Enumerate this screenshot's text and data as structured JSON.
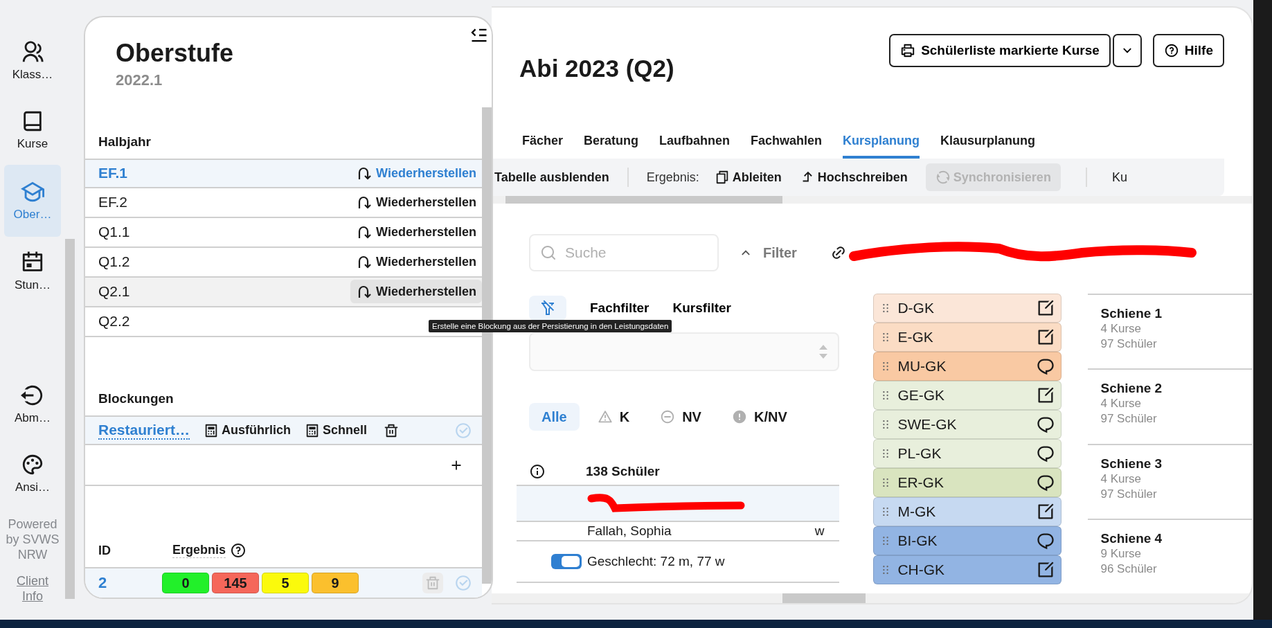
{
  "nav": {
    "items": [
      {
        "label": "Klass…",
        "selected": false
      },
      {
        "label": "Kurse",
        "selected": false
      },
      {
        "label": "Ober…",
        "selected": true
      },
      {
        "label": "Stun…",
        "selected": false
      }
    ],
    "bottom_items": [
      {
        "label": "Abm…"
      },
      {
        "label": "Ansi…"
      }
    ],
    "powered_by": "Powered by SVWS NRW",
    "client_info": "Client Info"
  },
  "sidebar": {
    "title": "Oberstufe",
    "subtitle": "2022.1",
    "halbjahr_heading": "Halbjahr",
    "halbjahre": [
      {
        "label": "EF.1",
        "action": "Wiederherstellen",
        "selected": true,
        "hovered": false
      },
      {
        "label": "EF.2",
        "action": "Wiederherstellen",
        "selected": false,
        "hovered": false
      },
      {
        "label": "Q1.1",
        "action": "Wiederherstellen",
        "selected": false,
        "hovered": false
      },
      {
        "label": "Q1.2",
        "action": "Wiederherstellen",
        "selected": false,
        "hovered": false
      },
      {
        "label": "Q2.1",
        "action": "Wiederherstellen",
        "selected": false,
        "hovered": true
      },
      {
        "label": "Q2.2",
        "selected": false,
        "hovered": false
      }
    ],
    "tooltip": "Erstelle eine Blockung aus der Persistierung in den Leistungsdaten",
    "blockungen_heading": "Blockungen",
    "blockungen": [
      {
        "name": "Restauriert…",
        "detailed": "Ausführlich",
        "quick": "Schnell",
        "selected": true
      }
    ],
    "results_columns": [
      "ID",
      "Ergebnis"
    ],
    "results": [
      {
        "id": "2",
        "selected": true,
        "delete_disabled": true,
        "badges": [
          {
            "value": "0",
            "color": "#22f02a"
          },
          {
            "value": "145",
            "color": "#f5675a"
          },
          {
            "value": "5",
            "color": "#fbfa0c"
          },
          {
            "value": "9",
            "color": "#fbc02d"
          }
        ]
      }
    ]
  },
  "main": {
    "title": "Abi 2023 (Q2)",
    "print_button": "Schülerliste markierte Kurse",
    "help_button": "Hilfe",
    "tabs": [
      {
        "label": "Fächer",
        "selected": false
      },
      {
        "label": "Beratung",
        "selected": false
      },
      {
        "label": "Laufbahnen",
        "selected": false
      },
      {
        "label": "Fachwahlen",
        "selected": false
      },
      {
        "label": "Kursplanung",
        "selected": true
      },
      {
        "label": "Klausurplanung",
        "selected": false
      }
    ],
    "toolbar": {
      "hide_table": "Tabelle ausblenden",
      "result_label": "Ergebnis:",
      "derive": "Ableiten",
      "write_up": "Hochschreiben",
      "sync": {
        "label": "Synchronisieren",
        "disabled": true
      },
      "cut_off": "Ku"
    },
    "search": {
      "placeholder": "Suche"
    },
    "filter": "Filter",
    "filter_tabs": [
      {
        "label": "Fachfilter"
      },
      {
        "label": "Kursfilter"
      }
    ],
    "status_filters": [
      {
        "label": "Alle",
        "selected": true
      },
      {
        "label": "K",
        "selected": false
      },
      {
        "label": "NV",
        "selected": false
      },
      {
        "label": "K/NV",
        "selected": false
      }
    ],
    "students_heading": "138 Schüler",
    "students": [
      {
        "selected": true
      },
      {
        "name": "Fallah, Sophia",
        "gender": "w",
        "selected": false
      }
    ],
    "gender_toggle": {
      "on": true,
      "label": "Geschlecht: 72 m, 77 w"
    },
    "courses": [
      {
        "label": "D-GK",
        "color": "#fbe6d8",
        "kind": "edit"
      },
      {
        "label": "E-GK",
        "color": "#fbdcc4",
        "kind": "edit"
      },
      {
        "label": "MU-GK",
        "color": "#f9c9a3",
        "kind": "comment"
      },
      {
        "label": "GE-GK",
        "color": "#e8efdc",
        "kind": "edit"
      },
      {
        "label": "SWE-GK",
        "color": "#e8efdc",
        "kind": "comment"
      },
      {
        "label": "PL-GK",
        "color": "#e8efdc",
        "kind": "comment"
      },
      {
        "label": "ER-GK",
        "color": "#d9e4bf",
        "kind": "comment"
      },
      {
        "label": "M-GK",
        "color": "#c6d9f1",
        "kind": "edit"
      },
      {
        "label": "BI-GK",
        "color": "#92b4e3",
        "kind": "comment"
      },
      {
        "label": "CH-GK",
        "color": "#92b4e3",
        "kind": "edit"
      }
    ],
    "schienen": [
      {
        "title": "Schiene 1",
        "courses": "4 Kurse",
        "students": "97 Schüler"
      },
      {
        "title": "Schiene 2",
        "courses": "4 Kurse",
        "students": "97 Schüler"
      },
      {
        "title": "Schiene 3",
        "courses": "4 Kurse",
        "students": "97 Schüler"
      },
      {
        "title": "Schiene 4",
        "courses": "9 Kurse",
        "students": "96 Schüler"
      }
    ]
  }
}
